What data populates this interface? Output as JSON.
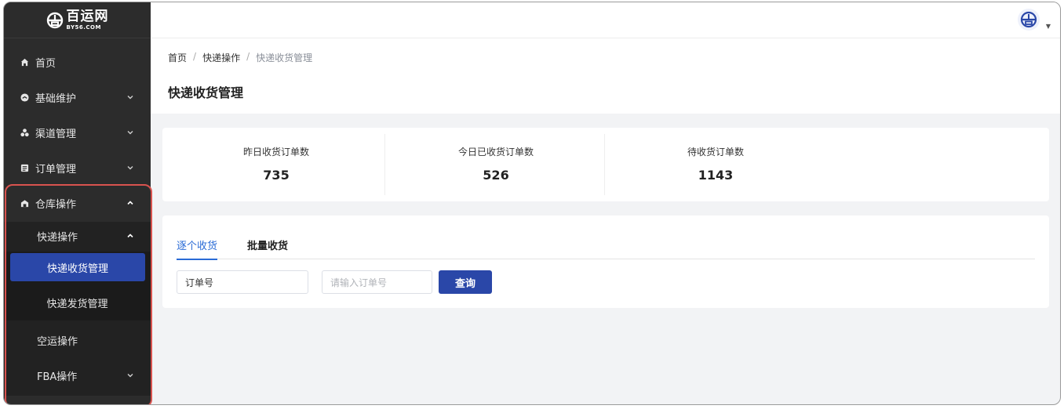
{
  "brand": {
    "name_cn": "百运网",
    "name_en": "BY56.COM"
  },
  "sidebar": {
    "items": [
      {
        "label": "首页",
        "icon": "home-icon"
      },
      {
        "label": "基础维护",
        "icon": "gauge-icon"
      },
      {
        "label": "渠道管理",
        "icon": "cluster-icon"
      },
      {
        "label": "订单管理",
        "icon": "list-icon"
      },
      {
        "label": "仓库操作",
        "icon": "warehouse-icon"
      }
    ],
    "warehouse_sub": {
      "express_ops": "快递操作",
      "express_receive": "快递收货管理",
      "express_ship": "快递发货管理",
      "air_ops": "空运操作",
      "fba_ops": "FBA操作"
    }
  },
  "breadcrumb": {
    "home": "首页",
    "sep": "/",
    "level2": "快递操作",
    "current": "快递收货管理"
  },
  "page_title": "快递收货管理",
  "stats": [
    {
      "label": "昨日收货订单数",
      "value": "735"
    },
    {
      "label": "今日已收货订单数",
      "value": "526"
    },
    {
      "label": "待收货订单数",
      "value": "1143"
    }
  ],
  "tabs": {
    "single": "逐个收货",
    "batch": "批量收货"
  },
  "form": {
    "field_select": "订单号",
    "order_placeholder": "请输入订单号",
    "query_button": "查询"
  },
  "colors": {
    "accent": "#2a47a8",
    "highlight": "#d9534f",
    "sidebar_bg": "#2c2c2c"
  }
}
